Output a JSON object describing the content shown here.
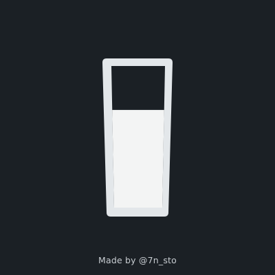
{
  "illustration": {
    "subject": "glass-of-milk-icon",
    "fill_level": 0.69,
    "colors": {
      "background": "#1b2025",
      "glass_rim": "#e3e7ea",
      "milk": "#f3f4f4",
      "glass_inner_empty": "#1b2025"
    }
  },
  "footer": {
    "credit": "Made by @7n_sto"
  }
}
